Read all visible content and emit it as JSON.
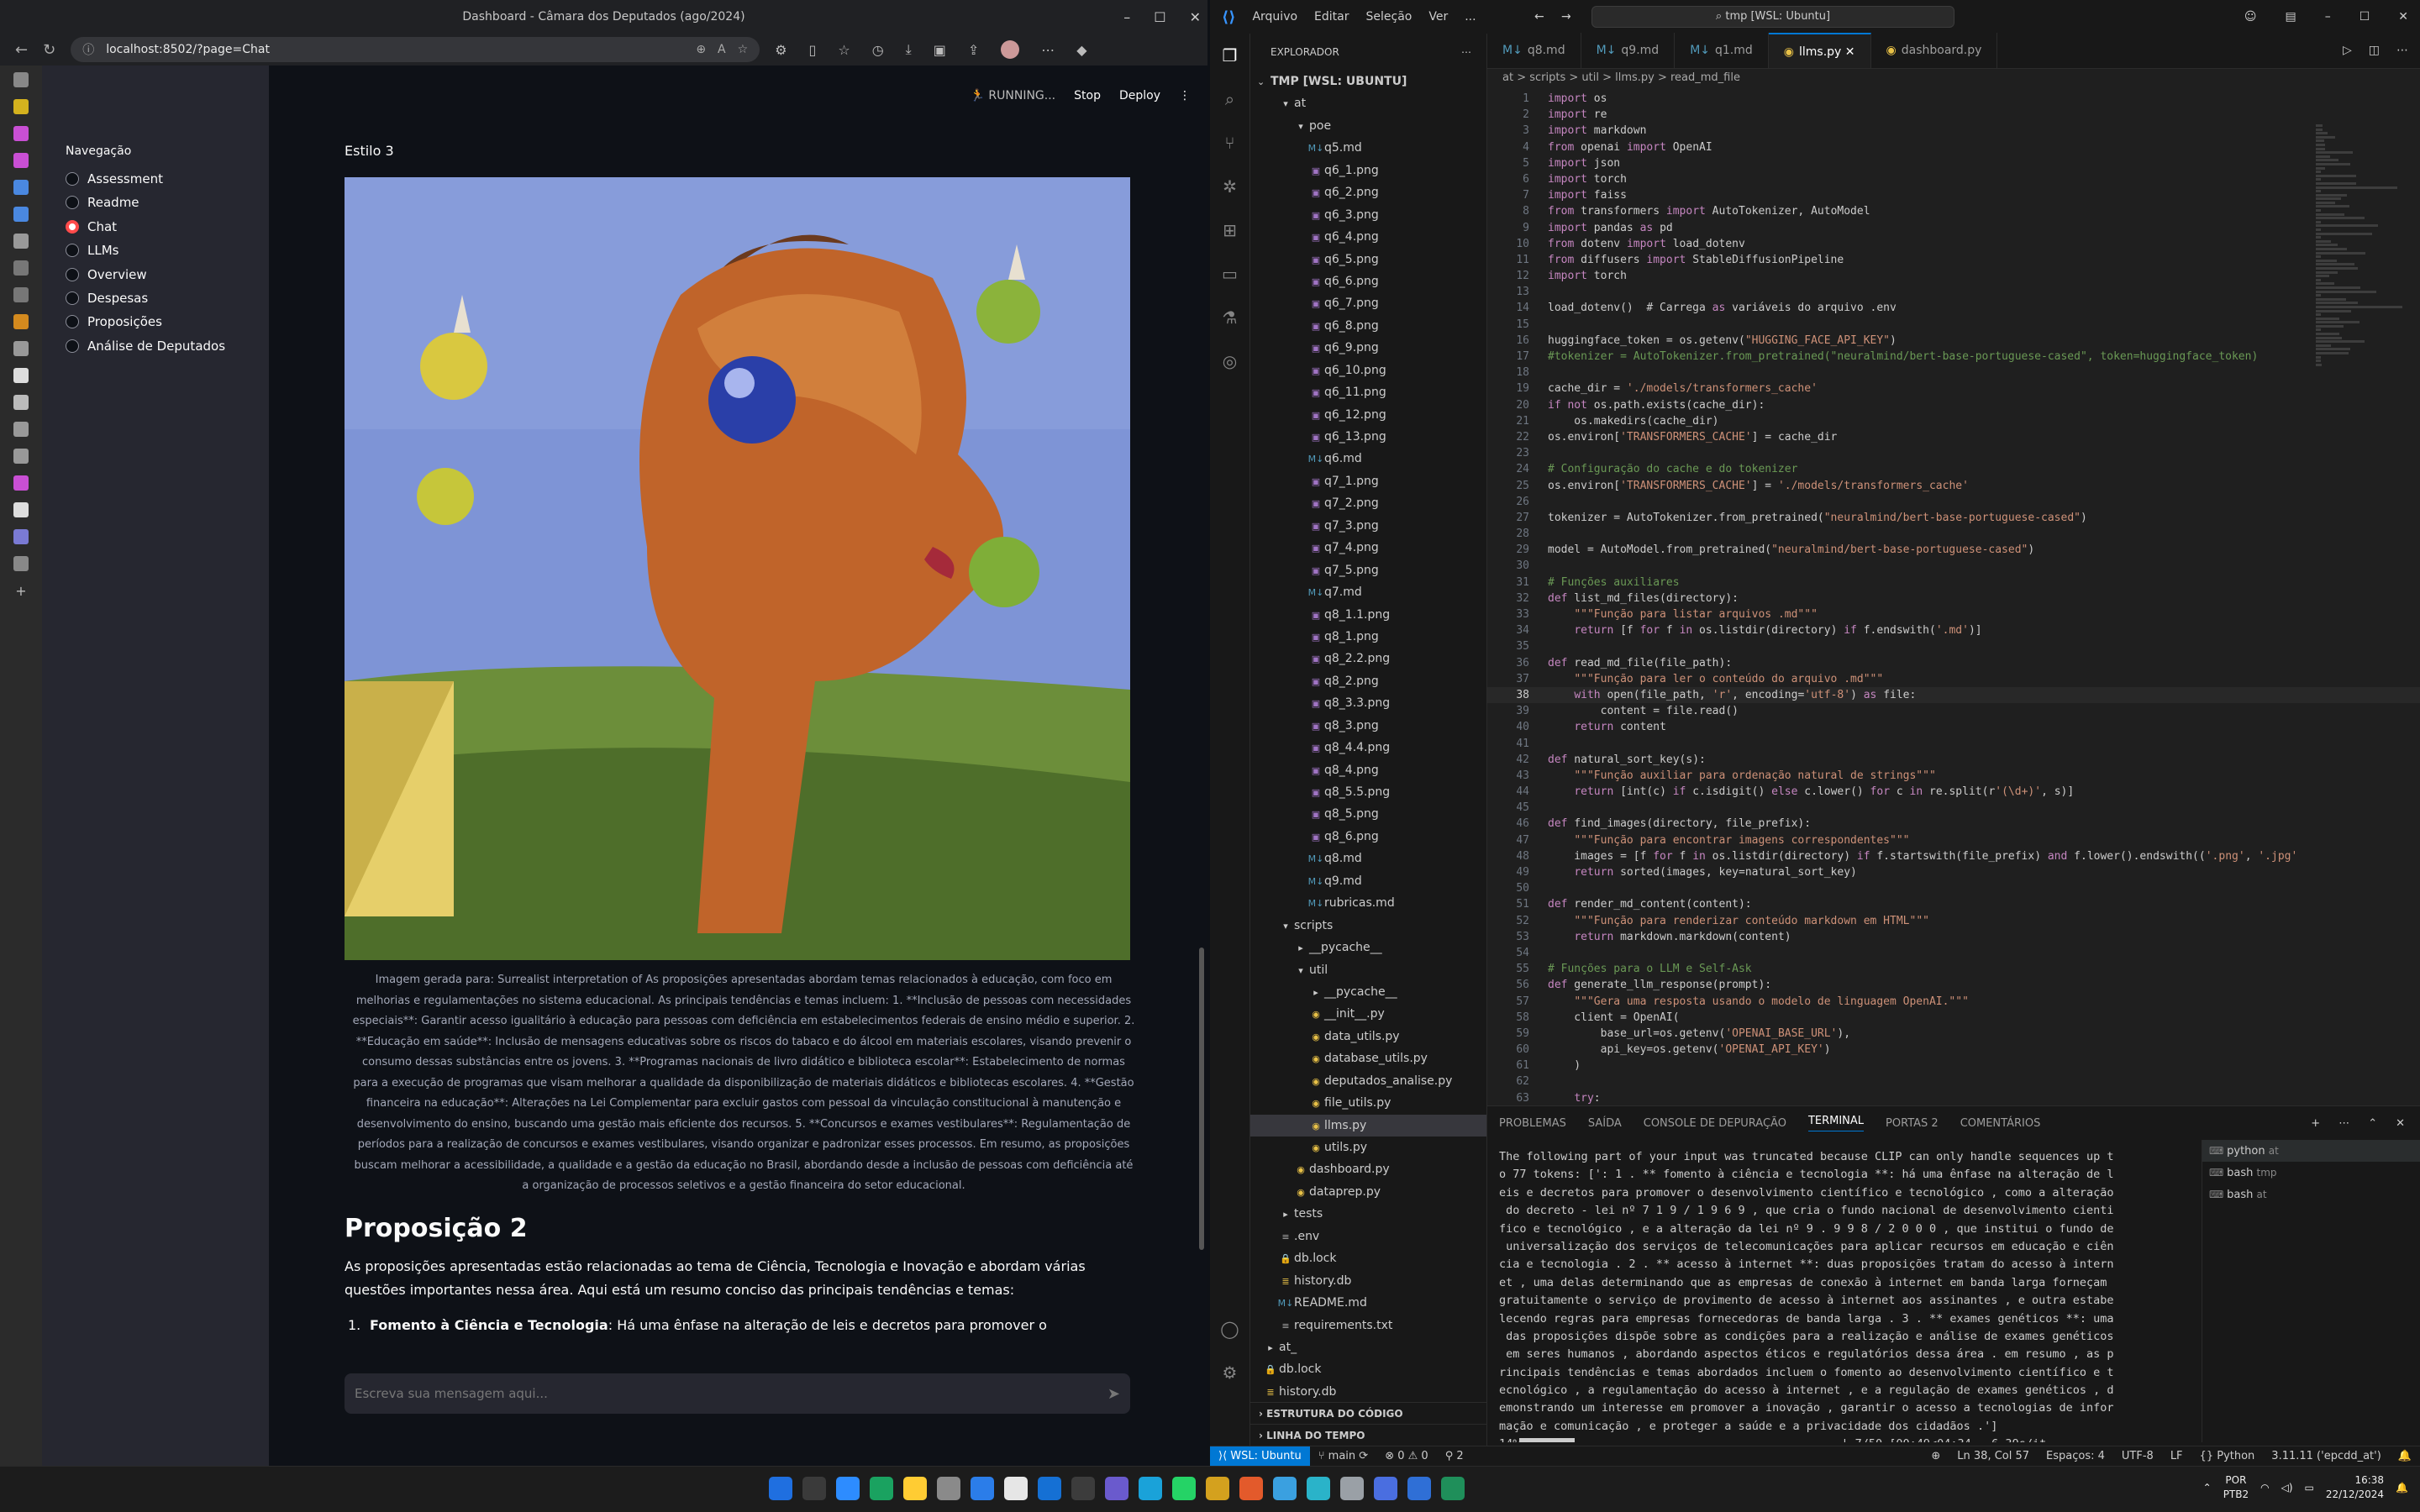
{
  "browser": {
    "title": "Dashboard - Câmara dos Deputados (ago/2024)",
    "url": "localhost:8502/?page=Chat"
  },
  "streamlit": {
    "nav_heading": "Navegação",
    "nav_items": [
      "Assessment",
      "Readme",
      "Chat",
      "LLMs",
      "Overview",
      "Despesas",
      "Proposições",
      "Análise de Deputados"
    ],
    "selected": "Chat",
    "status_running": "RUNNING...",
    "stop_label": "Stop",
    "deploy_label": "Deploy",
    "style_label": "Estilo 3",
    "image_caption": "Imagem gerada para: Surrealist interpretation of As proposições apresentadas abordam temas relacionados à educação, com foco em melhorias e regulamentações no sistema educacional. As principais tendências e temas incluem: 1. **Inclusão de pessoas com necessidades especiais**: Garantir acesso igualitário à educação para pessoas com deficiência em estabelecimentos federais de ensino médio e superior. 2. **Educação em saúde**: Inclusão de mensagens educativas sobre os riscos do tabaco e do álcool em materiais escolares, visando prevenir o consumo dessas substâncias entre os jovens. 3. **Programas nacionais de livro didático e biblioteca escolar**: Estabelecimento de normas para a execução de programas que visam melhorar a qualidade da disponibilização de materiais didáticos e bibliotecas escolares. 4. **Gestão financeira na educação**: Alterações na Lei Complementar para excluir gastos com pessoal da vinculação constitucional à manutenção e desenvolvimento do ensino, buscando uma gestão mais eficiente dos recursos. 5. **Concursos e exames vestibulares**: Regulamentação de períodos para a realização de concursos e exames vestibulares, visando organizar e padronizar esses processos. Em resumo, as proposições buscam melhorar a acessibilidade, a qualidade e a gestão da educação no Brasil, abordando desde a inclusão de pessoas com deficiência até a organização de processos seletivos e a gestão financeira do setor educacional.",
    "section_title": "Proposição 2",
    "section_intro": "As proposições apresentadas estão relacionadas ao tema de Ciência, Tecnologia e Inovação e abordam várias questões importantes nessa área. Aqui está um resumo conciso das principais tendências e temas:",
    "list_item_num": "1.",
    "list_item_bold": "Fomento à Ciência e Tecnologia",
    "list_item_text": ": Há uma ênfase na alteração de leis e decretos para promover o desenvolvimento",
    "chat_placeholder": "Escreva sua mensagem aqui..."
  },
  "vscode": {
    "menu": [
      "Arquivo",
      "Editar",
      "Seleção",
      "Ver",
      "..."
    ],
    "search": "tmp [WSL: Ubuntu]",
    "explorer_title": "EXPLORADOR",
    "root": "TMP [WSL: UBUNTU]",
    "tree": [
      {
        "d": 1,
        "t": "folder-open",
        "n": "at"
      },
      {
        "d": 2,
        "t": "folder-open",
        "n": "poe"
      },
      {
        "d": 3,
        "t": "md",
        "n": "q5.md"
      },
      {
        "d": 3,
        "t": "png",
        "n": "q6_1.png"
      },
      {
        "d": 3,
        "t": "png",
        "n": "q6_2.png"
      },
      {
        "d": 3,
        "t": "png",
        "n": "q6_3.png"
      },
      {
        "d": 3,
        "t": "png",
        "n": "q6_4.png"
      },
      {
        "d": 3,
        "t": "png",
        "n": "q6_5.png"
      },
      {
        "d": 3,
        "t": "png",
        "n": "q6_6.png"
      },
      {
        "d": 3,
        "t": "png",
        "n": "q6_7.png"
      },
      {
        "d": 3,
        "t": "png",
        "n": "q6_8.png"
      },
      {
        "d": 3,
        "t": "png",
        "n": "q6_9.png"
      },
      {
        "d": 3,
        "t": "png",
        "n": "q6_10.png"
      },
      {
        "d": 3,
        "t": "png",
        "n": "q6_11.png"
      },
      {
        "d": 3,
        "t": "png",
        "n": "q6_12.png"
      },
      {
        "d": 3,
        "t": "png",
        "n": "q6_13.png"
      },
      {
        "d": 3,
        "t": "md",
        "n": "q6.md"
      },
      {
        "d": 3,
        "t": "png",
        "n": "q7_1.png"
      },
      {
        "d": 3,
        "t": "png",
        "n": "q7_2.png"
      },
      {
        "d": 3,
        "t": "png",
        "n": "q7_3.png"
      },
      {
        "d": 3,
        "t": "png",
        "n": "q7_4.png"
      },
      {
        "d": 3,
        "t": "png",
        "n": "q7_5.png"
      },
      {
        "d": 3,
        "t": "md",
        "n": "q7.md"
      },
      {
        "d": 3,
        "t": "png",
        "n": "q8_1.1.png"
      },
      {
        "d": 3,
        "t": "png",
        "n": "q8_1.png"
      },
      {
        "d": 3,
        "t": "png",
        "n": "q8_2.2.png"
      },
      {
        "d": 3,
        "t": "png",
        "n": "q8_2.png"
      },
      {
        "d": 3,
        "t": "png",
        "n": "q8_3.3.png"
      },
      {
        "d": 3,
        "t": "png",
        "n": "q8_3.png"
      },
      {
        "d": 3,
        "t": "png",
        "n": "q8_4.4.png"
      },
      {
        "d": 3,
        "t": "png",
        "n": "q8_4.png"
      },
      {
        "d": 3,
        "t": "png",
        "n": "q8_5.5.png"
      },
      {
        "d": 3,
        "t": "png",
        "n": "q8_5.png"
      },
      {
        "d": 3,
        "t": "png",
        "n": "q8_6.png"
      },
      {
        "d": 3,
        "t": "md",
        "n": "q8.md"
      },
      {
        "d": 3,
        "t": "md",
        "n": "q9.md"
      },
      {
        "d": 3,
        "t": "md",
        "n": "rubricas.md"
      },
      {
        "d": 1,
        "t": "folder-open",
        "n": "scripts"
      },
      {
        "d": 2,
        "t": "folder",
        "n": "__pycache__"
      },
      {
        "d": 2,
        "t": "folder-open",
        "n": "util"
      },
      {
        "d": 3,
        "t": "folder",
        "n": "__pycache__"
      },
      {
        "d": 3,
        "t": "py",
        "n": "__init__.py"
      },
      {
        "d": 3,
        "t": "py",
        "n": "data_utils.py"
      },
      {
        "d": 3,
        "t": "py",
        "n": "database_utils.py"
      },
      {
        "d": 3,
        "t": "py",
        "n": "deputados_analise.py"
      },
      {
        "d": 3,
        "t": "py",
        "n": "file_utils.py"
      },
      {
        "d": 3,
        "t": "py",
        "n": "llms.py",
        "sel": true
      },
      {
        "d": 3,
        "t": "py",
        "n": "utils.py"
      },
      {
        "d": 2,
        "t": "py",
        "n": "dashboard.py"
      },
      {
        "d": 2,
        "t": "py",
        "n": "dataprep.py"
      },
      {
        "d": 1,
        "t": "folder",
        "n": "tests"
      },
      {
        "d": 1,
        "t": "file",
        "n": ".env"
      },
      {
        "d": 1,
        "t": "lock",
        "n": "db.lock"
      },
      {
        "d": 1,
        "t": "db",
        "n": "history.db"
      },
      {
        "d": 1,
        "t": "md",
        "n": "README.md"
      },
      {
        "d": 1,
        "t": "file",
        "n": "requirements.txt"
      },
      {
        "d": 0,
        "t": "folder",
        "n": "at_"
      },
      {
        "d": 0,
        "t": "lock",
        "n": "db.lock"
      },
      {
        "d": 0,
        "t": "db",
        "n": "history.db"
      }
    ],
    "outline": "ESTRUTURA DO CÓDIGO",
    "timeline": "LINHA DO TEMPO",
    "tabs": [
      {
        "t": "md",
        "n": "q8.md"
      },
      {
        "t": "md",
        "n": "q9.md"
      },
      {
        "t": "md",
        "n": "q1.md"
      },
      {
        "t": "py",
        "n": "llms.py",
        "active": true
      },
      {
        "t": "py",
        "n": "dashboard.py"
      }
    ],
    "breadcrumb": "at > scripts > util > llms.py > read_md_file",
    "current_line": 38,
    "code": [
      "import os",
      "import re",
      "import markdown",
      "from openai import OpenAI",
      "import json",
      "import torch",
      "import faiss",
      "from transformers import AutoTokenizer, AutoModel",
      "import pandas as pd",
      "from dotenv import load_dotenv",
      "from diffusers import StableDiffusionPipeline",
      "import torch",
      "",
      "load_dotenv()  # Carrega as variáveis do arquivo .env",
      "",
      "huggingface_token = os.getenv(\"HUGGING_FACE_API_KEY\")",
      "#tokenizer = AutoTokenizer.from_pretrained(\"neuralmind/bert-base-portuguese-cased\", token=huggingface_token)",
      "",
      "cache_dir = './models/transformers_cache'",
      "if not os.path.exists(cache_dir):",
      "    os.makedirs(cache_dir)",
      "os.environ['TRANSFORMERS_CACHE'] = cache_dir",
      "",
      "# Configuração do cache e do tokenizer",
      "os.environ['TRANSFORMERS_CACHE'] = './models/transformers_cache'",
      "",
      "tokenizer = AutoTokenizer.from_pretrained(\"neuralmind/bert-base-portuguese-cased\")",
      "",
      "model = AutoModel.from_pretrained(\"neuralmind/bert-base-portuguese-cased\")",
      "",
      "# Funções auxiliares",
      "def list_md_files(directory):",
      "    \"\"\"Função para listar arquivos .md\"\"\"",
      "    return [f for f in os.listdir(directory) if f.endswith('.md')]",
      "",
      "def read_md_file(file_path):",
      "    \"\"\"Função para ler o conteúdo do arquivo .md\"\"\"",
      "    with open(file_path, 'r', encoding='utf-8') as file:",
      "        content = file.read()",
      "    return content",
      "",
      "def natural_sort_key(s):",
      "    \"\"\"Função auxiliar para ordenação natural de strings\"\"\"",
      "    return [int(c) if c.isdigit() else c.lower() for c in re.split(r'(\\d+)', s)]",
      "",
      "def find_images(directory, file_prefix):",
      "    \"\"\"Função para encontrar imagens correspondentes\"\"\"",
      "    images = [f for f in os.listdir(directory) if f.startswith(file_prefix) and f.lower().endswith(('.png', '.jpg'",
      "    return sorted(images, key=natural_sort_key)",
      "",
      "def render_md_content(content):",
      "    \"\"\"Função para renderizar conteúdo markdown em HTML\"\"\"",
      "    return markdown.markdown(content)",
      "",
      "# Funções para o LLM e Self-Ask",
      "def generate_llm_response(prompt):",
      "    \"\"\"Gera uma resposta usando o modelo de linguagem OpenAI.\"\"\"",
      "    client = OpenAI(",
      "        base_url=os.getenv('OPENAI_BASE_URL'),",
      "        api_key=os.getenv('OPENAI_API_KEY')",
      "    )",
      "",
      "    try:"
    ],
    "panel_tabs": [
      "PROBLEMAS",
      "SAÍDA",
      "CONSOLE DE DEPURAÇÃO",
      "TERMINAL",
      "PORTAS 2",
      "COMENTÁRIOS"
    ],
    "active_panel_tab": "TERMINAL",
    "terminal_lines": [
      "The following part of your input was truncated because CLIP can only handle sequences up t",
      "o 77 tokens: [': 1 . ** fomento à ciência e tecnologia **: há uma ênfase na alteração de l",
      "eis e decretos para promover o desenvolvimento científico e tecnológico , como a alteração",
      " do decreto - lei nº 7 1 9 / 1 9 6 9 , que cria o fundo nacional de desenvolvimento cienti",
      "fico e tecnológico , e a alteração da lei nº 9 . 9 9 8 / 2 0 0 0 , que institui o fundo de",
      " universalização dos serviços de telecomunicações para aplicar recursos em educação e ciên",
      "cia e tecnologia . 2 . ** acesso à internet **: duas proposições tratam do acesso à intern",
      "et , uma delas determinando que as empresas de conexão à internet em banda larga forneçam",
      "gratuitamente o serviço de provimento de acesso à internet aos assinantes , e outra estabe",
      "lecendo regras para empresas fornecedoras de banda larga . 3 . ** exames genéticos **: uma",
      " das proposições dispõe sobre as condições para a realização e análise de exames genéticos",
      " em seres humanos , abordando aspectos éticos e regulatórios dessa área . em resumo , as p",
      "rincipais tendências e temas abordados incluem o fomento ao desenvolvimento científico e t",
      "ecnológico , a regulamentação do acesso à internet , e a regulação de exames genéticos , d",
      "emonstrando um interesse em promover a inovação , garantir o acesso a tecnologias de infor",
      "mação e comunicação , e proteger a saúde e a privacidade dos cidadãos .']"
    ],
    "progress_text": "                                       | 7/50 [00:49<04:34,  6.39s/it",
    "progress_pct": "14%",
    "terminals": [
      {
        "n": "python",
        "s": "at"
      },
      {
        "n": "bash",
        "s": "tmp"
      },
      {
        "n": "bash",
        "s": "at"
      }
    ],
    "status": {
      "remote": "WSL: Ubuntu",
      "branch": "main",
      "errors": "0",
      "warnings": "0",
      "ports": "2",
      "position": "Ln 38, Col 57",
      "spaces": "Espaços: 4",
      "encoding": "UTF-8",
      "eol": "LF",
      "language": "Python",
      "interpreter": "3.11.11 ('epcdd_at')"
    }
  },
  "taskbar": {
    "lang1": "POR",
    "lang2": "PTB2",
    "time": "16:38",
    "date": "22/12/2024",
    "app_colors": [
      "#1f6fe0",
      "#3a3a3a",
      "#2d8cff",
      "#1aa260",
      "#ffcc33",
      "#8a8a8a",
      "#2b7de9",
      "#e6e6e6",
      "#1570d4",
      "#3c3c3c",
      "#6a5acd",
      "#1aa2d9",
      "#25d366",
      "#d4a11e",
      "#e35a2b",
      "#3aa0e0",
      "#2ab3c9",
      "#9aa0a6",
      "#4a6ee0",
      "#2f6fd6",
      "#1f8f5a"
    ]
  }
}
